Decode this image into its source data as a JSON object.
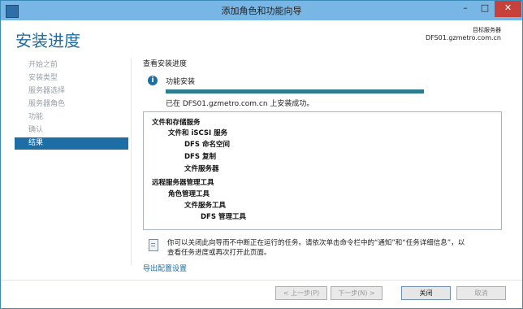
{
  "window": {
    "title": "添加角色和功能向导",
    "minimize": "–",
    "maximize": "□",
    "close": "✕"
  },
  "header": {
    "page_title": "安装进度",
    "destination_label": "目标服务器",
    "destination_server": "DFS01.gzmetro.com.cn"
  },
  "nav": {
    "items": [
      {
        "label": "开始之前",
        "active": false
      },
      {
        "label": "安装类型",
        "active": false
      },
      {
        "label": "服务器选择",
        "active": false
      },
      {
        "label": "服务器角色",
        "active": false
      },
      {
        "label": "功能",
        "active": false
      },
      {
        "label": "确认",
        "active": false
      },
      {
        "label": "结果",
        "active": true
      }
    ]
  },
  "content": {
    "section_title": "查看安装进度",
    "feature_install_label": "功能安装",
    "progress_fraction": 1.0,
    "result_text": "已在 DFS01.gzmetro.com.cn 上安装成功。",
    "tree": [
      {
        "label": "文件和存储服务",
        "level": 0
      },
      {
        "label": "文件和 iSCSI 服务",
        "level": 1
      },
      {
        "label": "DFS 命名空间",
        "level": 2
      },
      {
        "label": "DFS 复制",
        "level": 2
      },
      {
        "label": "文件服务器",
        "level": 2
      },
      {
        "label": "远程服务器管理工具",
        "level": 0
      },
      {
        "label": "角色管理工具",
        "level": 1
      },
      {
        "label": "文件服务工具",
        "level": 2
      },
      {
        "label": "DFS 管理工具",
        "level": 3
      }
    ],
    "note_line1": "你可以关闭此向导而不中断正在运行的任务。请依次单击命令栏中的“通知”和“任务详细信息”，以",
    "note_line2": "查看任务进度或再次打开此页面。",
    "export_link": "导出配置设置"
  },
  "footer": {
    "prev_label": "< 上一步(P)",
    "next_label": "下一步(N) >",
    "close_label": "关闭",
    "cancel_label": "取消"
  },
  "colors": {
    "accent": "#1c6ea4",
    "titlebar": "#78b7e5",
    "progress": "#2d7d8f"
  }
}
